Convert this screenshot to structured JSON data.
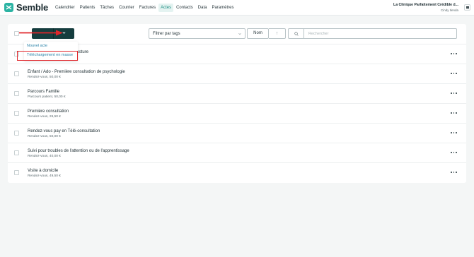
{
  "app": {
    "brand": "Semble",
    "nav": [
      "Calendrier",
      "Patients",
      "Tâches",
      "Courrier",
      "Factures",
      "Actes",
      "Contacts",
      "Data",
      "Paramètres"
    ],
    "active_nav": "Actes",
    "clinic_name": "La Clinique Parfaitement Crédible d...",
    "user_name": "Cindy Ilenda"
  },
  "toolbar": {
    "tag_filter_label": "Filtrer par tags",
    "sort_label": "Nom",
    "sort_direction_symbol": "↑",
    "search_placeholder": "Rechercher"
  },
  "dropdown": {
    "items": [
      "Nouvel acte",
      "Téléchargement en masse"
    ],
    "highlighted_index": 1
  },
  "rows": [
    {
      "title": "Adulte - Rééducation ou posture",
      "sub": ""
    },
    {
      "title": "Enfant / Ado - Première consultation de psychologie",
      "sub": "Rendez-vous, 50,00 €"
    },
    {
      "title": "Parcours Famille",
      "sub": "Parcours patient, 50,00 €"
    },
    {
      "title": "Première consultation",
      "sub": "Rendez-vous, 26,50 €"
    },
    {
      "title": "Rendez-vous pay en Télé-consultation",
      "sub": "Rendez-vous, 50,00 €"
    },
    {
      "title": "Suivi pour troubles de l'attention ou de l'apprentissage",
      "sub": "Rendez-vous, 40,00 €"
    },
    {
      "title": "Visite à domicile",
      "sub": "Rendez-vous, 49,50 €"
    }
  ],
  "colors": {
    "brand": "#2bb3a3",
    "primary_button": "#153d3e",
    "annotation": "#e0262b",
    "link": "#2a82a8"
  }
}
